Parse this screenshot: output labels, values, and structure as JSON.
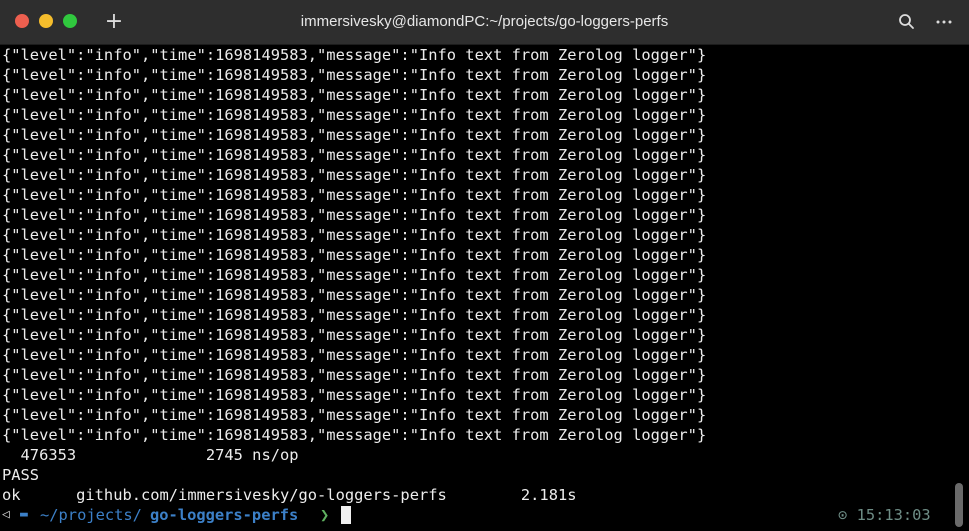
{
  "window": {
    "title": "immersivesky@diamondPC:~/projects/go-loggers-perfs",
    "new_tab_label": "+",
    "icons": {
      "close": "close-icon",
      "minimize": "minimize-icon",
      "maximize": "maximize-icon",
      "search": "search-icon",
      "menu": "more-menu-icon"
    }
  },
  "terminal": {
    "log_lines": [
      "{\"level\":\"info\",\"time\":1698149583,\"message\":\"Info text from Zerolog logger\"}",
      "{\"level\":\"info\",\"time\":1698149583,\"message\":\"Info text from Zerolog logger\"}",
      "{\"level\":\"info\",\"time\":1698149583,\"message\":\"Info text from Zerolog logger\"}",
      "{\"level\":\"info\",\"time\":1698149583,\"message\":\"Info text from Zerolog logger\"}",
      "{\"level\":\"info\",\"time\":1698149583,\"message\":\"Info text from Zerolog logger\"}",
      "{\"level\":\"info\",\"time\":1698149583,\"message\":\"Info text from Zerolog logger\"}",
      "{\"level\":\"info\",\"time\":1698149583,\"message\":\"Info text from Zerolog logger\"}",
      "{\"level\":\"info\",\"time\":1698149583,\"message\":\"Info text from Zerolog logger\"}",
      "{\"level\":\"info\",\"time\":1698149583,\"message\":\"Info text from Zerolog logger\"}",
      "{\"level\":\"info\",\"time\":1698149583,\"message\":\"Info text from Zerolog logger\"}",
      "{\"level\":\"info\",\"time\":1698149583,\"message\":\"Info text from Zerolog logger\"}",
      "{\"level\":\"info\",\"time\":1698149583,\"message\":\"Info text from Zerolog logger\"}",
      "{\"level\":\"info\",\"time\":1698149583,\"message\":\"Info text from Zerolog logger\"}",
      "{\"level\":\"info\",\"time\":1698149583,\"message\":\"Info text from Zerolog logger\"}",
      "{\"level\":\"info\",\"time\":1698149583,\"message\":\"Info text from Zerolog logger\"}",
      "{\"level\":\"info\",\"time\":1698149583,\"message\":\"Info text from Zerolog logger\"}",
      "{\"level\":\"info\",\"time\":1698149583,\"message\":\"Info text from Zerolog logger\"}",
      "{\"level\":\"info\",\"time\":1698149583,\"message\":\"Info text from Zerolog logger\"}",
      "{\"level\":\"info\",\"time\":1698149583,\"message\":\"Info text from Zerolog logger\"}",
      "{\"level\":\"info\",\"time\":1698149583,\"message\":\"Info text from Zerolog logger\"}"
    ],
    "bench_line": "  476353              2745 ns/op",
    "pass_line": "PASS",
    "ok_line": "ok      github.com/immersivesky/go-loggers-perfs        2.181s",
    "prompt": {
      "os_icon": "linux-icon",
      "folder_icon": "folder-icon",
      "dir_prefix": "~/projects/",
      "dir_name": "go-loggers-perfs",
      "arrow": "❯",
      "clock_icon": "clock-icon",
      "time": "15:13:03"
    }
  },
  "colors": {
    "titlebar": "#2e2e2e",
    "terminal_bg": "#000000",
    "text": "#ededed",
    "prompt_dir": "#3c80c8",
    "prompt_arrow": "#5fb060",
    "clock": "#6e8d86"
  }
}
